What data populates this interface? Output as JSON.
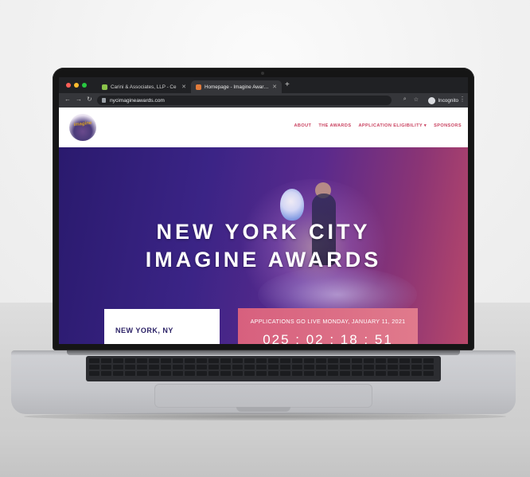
{
  "browser": {
    "tabs": [
      {
        "title": "Carini & Associates, LLP - Ce",
        "active": false,
        "favicon_color": "#8bc34a"
      },
      {
        "title": "Homepage - Imagine Awards N",
        "active": true,
        "favicon_color": "#e07a3a"
      }
    ],
    "new_tab": "+",
    "url": "nycimagineawards.com",
    "profile_label": "Incognito"
  },
  "site": {
    "logo_text": "imagine",
    "nav": [
      "ABOUT",
      "THE AWARDS",
      "APPLICATION ELIGIBILITY ▾",
      "SPONSORS"
    ],
    "hero": {
      "title_line1": "NEW YORK CITY",
      "title_line2": "IMAGINE AWARDS"
    },
    "location": "NEW YORK, NY",
    "countdown": {
      "label": "APPLICATIONS GO LIVE MONDAY, JANUARY 11, 2021",
      "time": "025 : 02 : 18 : 51"
    }
  },
  "colors": {
    "nav_accent": "#c9415f",
    "hero_start": "#2a1a6e",
    "hero_end": "#b9486a",
    "countdown_bg": "#d7607e"
  }
}
